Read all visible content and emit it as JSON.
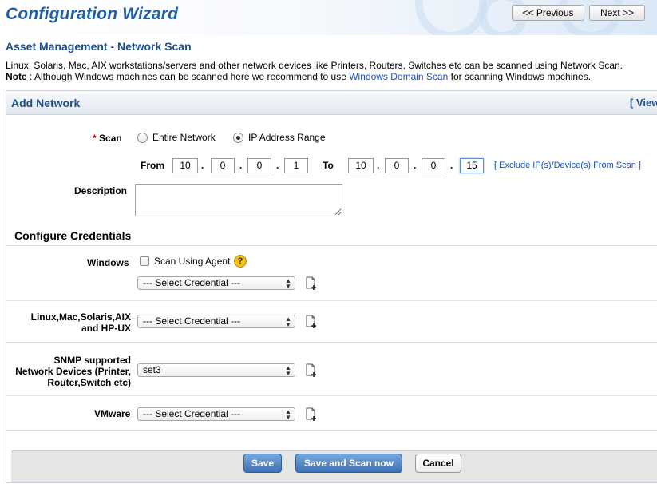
{
  "header": {
    "title": "Configuration Wizard",
    "previous_label": "<< Previous",
    "next_label": "Next >>"
  },
  "page": {
    "title": "Asset Management - Network Scan",
    "intro_line1": "Linux, Solaris, Mac, AIX workstations/servers and other network devices like Printers, Routers, Switches etc can be scanned using Network Scan.",
    "note_label": "Note",
    "note_text": " : Although Windows machines can be scanned here we recommend to use ",
    "note_link": "Windows Domain Scan",
    "note_tail": " for scanning Windows machines."
  },
  "panel": {
    "title": "Add Network",
    "view_link": "[ View"
  },
  "scan": {
    "required_mark": "*",
    "label": "Scan",
    "option_entire": "Entire Network",
    "option_range": "IP Address Range",
    "selected": "IP Address Range",
    "from_label": "From",
    "to_label": "To",
    "from_ip": [
      "10",
      "0",
      "0",
      "1"
    ],
    "to_ip": [
      "10",
      "0",
      "0",
      "15"
    ],
    "dot": ".",
    "exclude_link": "[ Exclude IP(s)/Device(s) From Scan ]"
  },
  "description": {
    "label": "Description",
    "value": ""
  },
  "credentials": {
    "section_title": "Configure Credentials",
    "windows_label": "Windows",
    "scan_agent_label": "Scan Using Agent",
    "scan_agent_checked": false,
    "help_glyph": "?",
    "windows_select": "--- Select Credential ---",
    "linux_label_line1": "Linux,Mac,Solaris,AIX",
    "linux_label_line2": "and HP-UX",
    "linux_select": "--- Select Credential ---",
    "snmp_label_line1": "SNMP supported",
    "snmp_label_line2": "Network Devices (Printer,",
    "snmp_label_line3": "Router,Switch etc)",
    "snmp_select": "set3",
    "vmware_label": "VMware",
    "vmware_select": "--- Select Credential ---"
  },
  "footer": {
    "save_label": "Save",
    "save_scan_label": "Save and Scan now",
    "cancel_label": "Cancel"
  },
  "colors": {
    "title_blue": "#1f5fa6",
    "heading_blue": "#1e4f8a",
    "link_blue": "#1a4fb8",
    "required_red": "#d00000",
    "button_blue": "#3d70b5"
  }
}
